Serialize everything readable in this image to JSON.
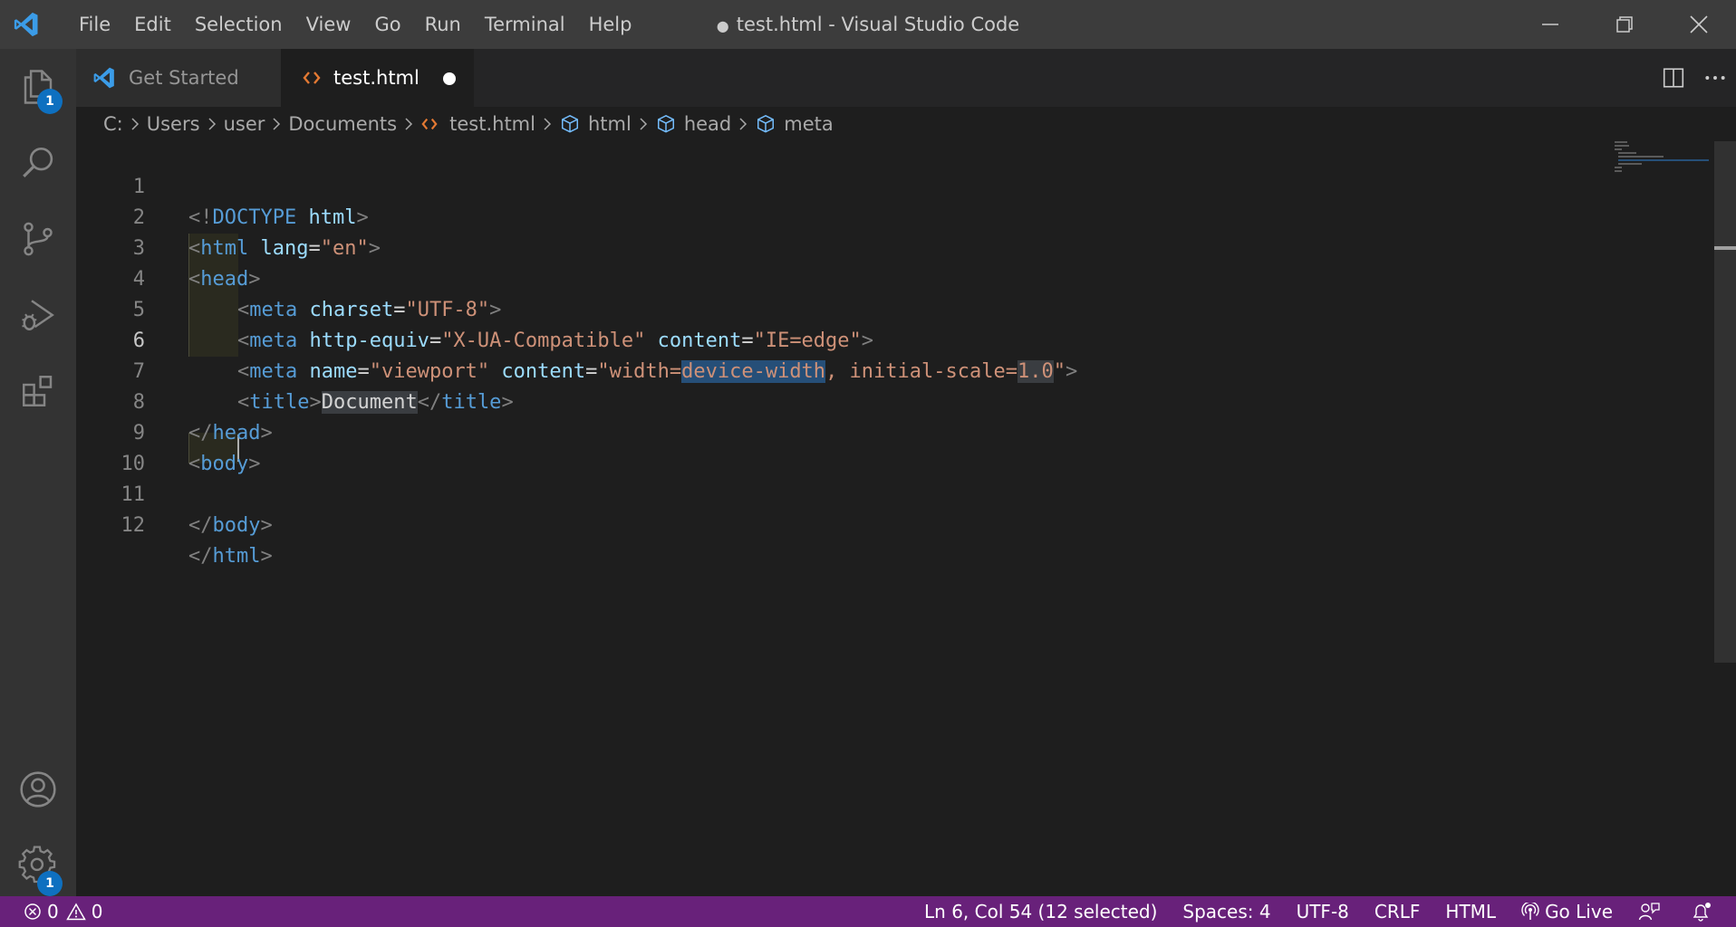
{
  "titlebar": {
    "menu": [
      "File",
      "Edit",
      "Selection",
      "View",
      "Go",
      "Run",
      "Terminal",
      "Help"
    ],
    "dirty_marker": "●",
    "title": "test.html - Visual Studio Code"
  },
  "activitybar": {
    "items": [
      "files-icon",
      "search-icon",
      "source-control-icon",
      "run-debug-icon",
      "extensions-icon"
    ],
    "explorer_badge": "1",
    "settings_badge": "1"
  },
  "tabs": [
    {
      "label": "Get Started",
      "icon": "vscode-icon",
      "active": false
    },
    {
      "label": "test.html",
      "icon": "html-code-icon",
      "active": true,
      "dirty": true
    }
  ],
  "breadcrumb": [
    "C:",
    "Users",
    "user",
    "Documents",
    "test.html",
    "html",
    "head",
    "meta"
  ],
  "editor": {
    "current_line": 6,
    "line_numbers": [
      "1",
      "2",
      "3",
      "4",
      "5",
      "6",
      "7",
      "8",
      "9",
      "10",
      "11",
      "12"
    ]
  },
  "code": {
    "l1": {
      "a": "<!",
      "b": "DOCTYPE",
      "c": " html",
      "d": ">"
    },
    "l2": {
      "a": "<",
      "b": "html",
      "c": " lang",
      "d": "=",
      "e": "\"en\"",
      "f": ">"
    },
    "l3": {
      "a": "<",
      "b": "head",
      "c": ">"
    },
    "l4": {
      "a": "<",
      "b": "meta",
      "c": " charset",
      "d": "=",
      "e": "\"UTF-8\"",
      "f": ">"
    },
    "l5": {
      "a": "<",
      "b": "meta",
      "c": " http-equiv",
      "d": "=",
      "e": "\"X-UA-Compatible\"",
      "f": " content",
      "g": "=",
      "h": "\"IE=edge\"",
      "i": ">"
    },
    "l6": {
      "a": "<",
      "b": "meta",
      "c": " name",
      "d": "=",
      "e": "\"viewport\"",
      "f": " content",
      "g": "=",
      "h1": "\"width=",
      "h2": "device-width",
      "h3": ", initial-scale=",
      "h4": "1.0",
      "h5": "\"",
      "i": ">"
    },
    "l7": {
      "a": "<",
      "b": "title",
      "c": ">",
      "d": "Document",
      "e": "</",
      "f": "title",
      "g": ">"
    },
    "l8": {
      "a": "</",
      "b": "head",
      "c": ">"
    },
    "l9": {
      "a": "<",
      "b": "body",
      "c": ">"
    },
    "l11": {
      "a": "</",
      "b": "body",
      "c": ">"
    },
    "l12": {
      "a": "</",
      "b": "html",
      "c": ">"
    }
  },
  "statusbar": {
    "errors": "0",
    "warnings": "0",
    "position": "Ln 6, Col 54 (12 selected)",
    "spaces": "Spaces: 4",
    "encoding": "UTF-8",
    "eol": "CRLF",
    "language": "HTML",
    "go_live": "Go Live"
  },
  "colors": {
    "statusbar": "#68217a",
    "titlebar": "#3c3c3c",
    "activitybar": "#333333",
    "editor": "#1e1e1e",
    "tag": "#569cd6",
    "attr": "#9cdcfe",
    "string": "#ce9178",
    "badge": "#0e70c0"
  }
}
